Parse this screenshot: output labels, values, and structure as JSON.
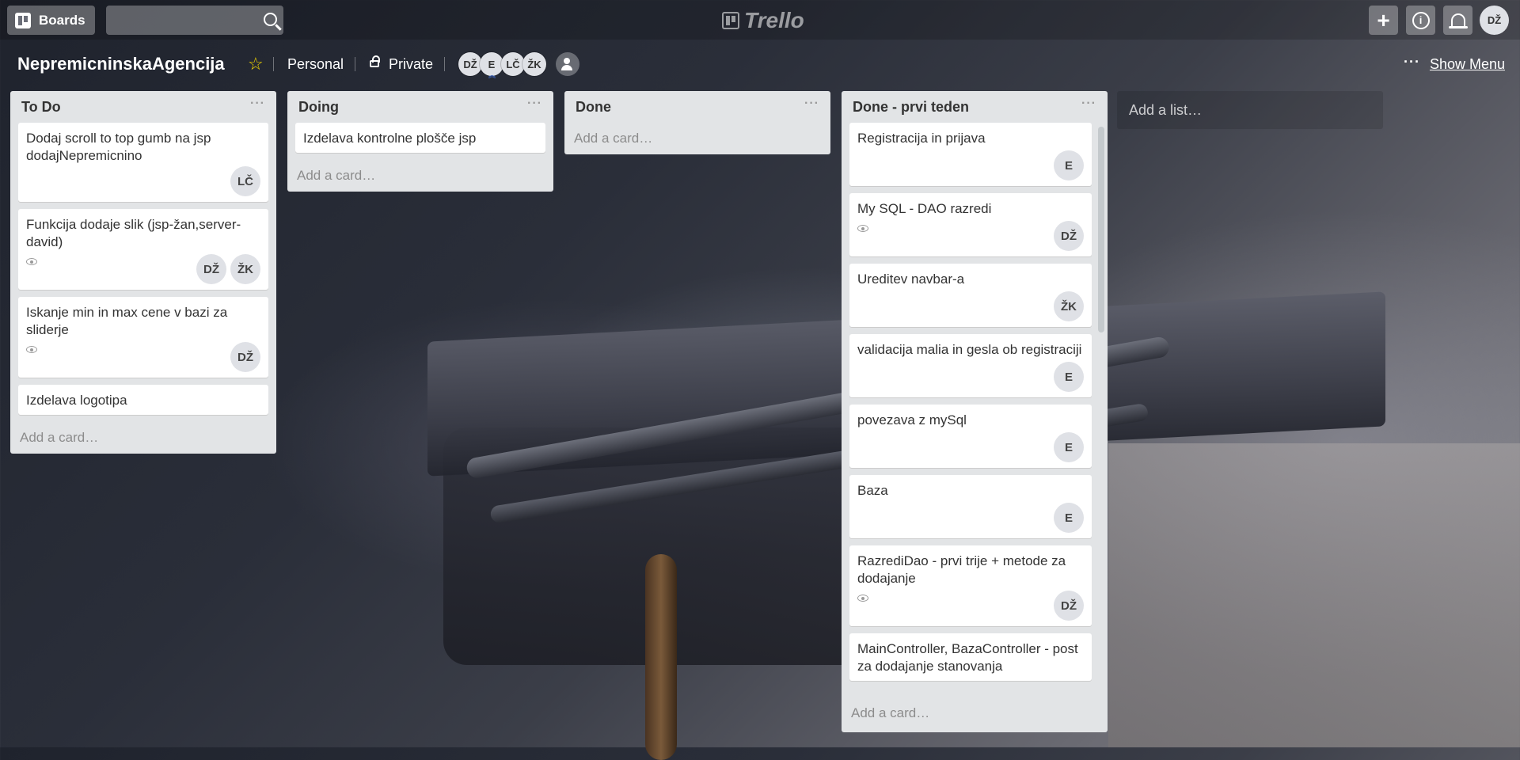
{
  "header": {
    "boards_label": "Boards",
    "search_placeholder": "",
    "logo_text": "Trello",
    "user_initials": "DŽ"
  },
  "board": {
    "name": "NepremicninskaAgencija",
    "team": "Personal",
    "visibility": "Private",
    "members": [
      "DŽ",
      "E",
      "LČ",
      "ŽK"
    ],
    "show_menu": "Show Menu",
    "add_list": "Add a list…"
  },
  "lists": [
    {
      "title": "To Do",
      "add_card": "Add a card…",
      "cards": [
        {
          "title": "Dodaj scroll to top gumb na jsp dodajNepremicnino",
          "watch": false,
          "members": [
            "LČ"
          ]
        },
        {
          "title": "Funkcija dodaje slik (jsp-žan,server-david)",
          "watch": true,
          "members": [
            "DŽ",
            "ŽK"
          ]
        },
        {
          "title": "Iskanje min in max cene v bazi za sliderje",
          "watch": true,
          "members": [
            "DŽ"
          ]
        },
        {
          "title": "Izdelava logotipa",
          "watch": false,
          "members": []
        }
      ]
    },
    {
      "title": "Doing",
      "add_card": "Add a card…",
      "cards": [
        {
          "title": "Izdelava kontrolne plošče jsp",
          "watch": false,
          "members": []
        }
      ]
    },
    {
      "title": "Done",
      "add_card": "Add a card…",
      "cards": []
    },
    {
      "title": "Done - prvi teden",
      "add_card": "Add a card…",
      "cards": [
        {
          "title": "Registracija in prijava",
          "watch": false,
          "members": [
            "E"
          ]
        },
        {
          "title": "My SQL - DAO razredi",
          "watch": true,
          "members": [
            "DŽ"
          ]
        },
        {
          "title": "Ureditev navbar-a",
          "watch": false,
          "members": [
            "ŽK"
          ]
        },
        {
          "title": "validacija malia in gesla ob registraciji",
          "watch": false,
          "members": [
            "E"
          ]
        },
        {
          "title": "povezava z mySql",
          "watch": false,
          "members": [
            "E"
          ]
        },
        {
          "title": "Baza",
          "watch": false,
          "members": [
            "E"
          ]
        },
        {
          "title": "RazrediDao - prvi trije + metode za dodajanje",
          "watch": true,
          "members": [
            "DŽ"
          ]
        },
        {
          "title": "MainController, BazaController - post za dodajanje stanovanja",
          "watch": false,
          "members": []
        }
      ]
    }
  ]
}
